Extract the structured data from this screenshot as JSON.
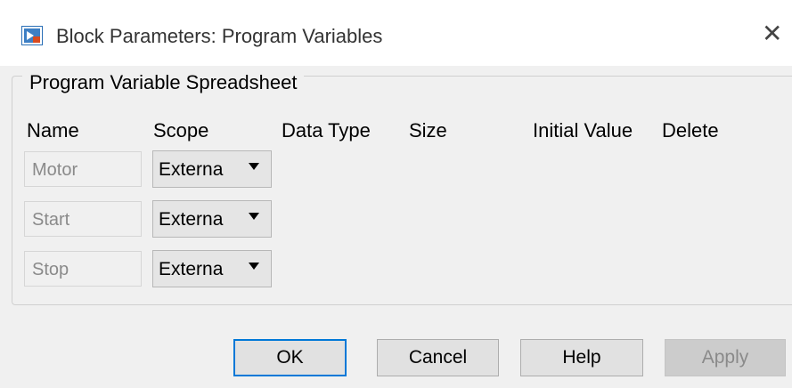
{
  "window": {
    "title": "Block Parameters: Program Variables",
    "icon": "simulink-block-icon",
    "close_icon": "close-icon"
  },
  "group": {
    "title": "Program Variable Spreadsheet"
  },
  "table": {
    "headers": {
      "name": "Name",
      "scope": "Scope",
      "data_type": "Data Type",
      "size": "Size",
      "initial_value": "Initial Value",
      "delete": "Delete"
    },
    "rows": [
      {
        "name": "Motor",
        "scope": "Externa"
      },
      {
        "name": "Start",
        "scope": "Externa"
      },
      {
        "name": "Stop",
        "scope": "Externa"
      }
    ]
  },
  "buttons": {
    "ok": "OK",
    "cancel": "Cancel",
    "help": "Help",
    "apply": "Apply"
  },
  "colors": {
    "dialog_bg": "#f0f0f0",
    "default_button_border": "#0078d7",
    "disabled_text": "#8a8a8a"
  }
}
